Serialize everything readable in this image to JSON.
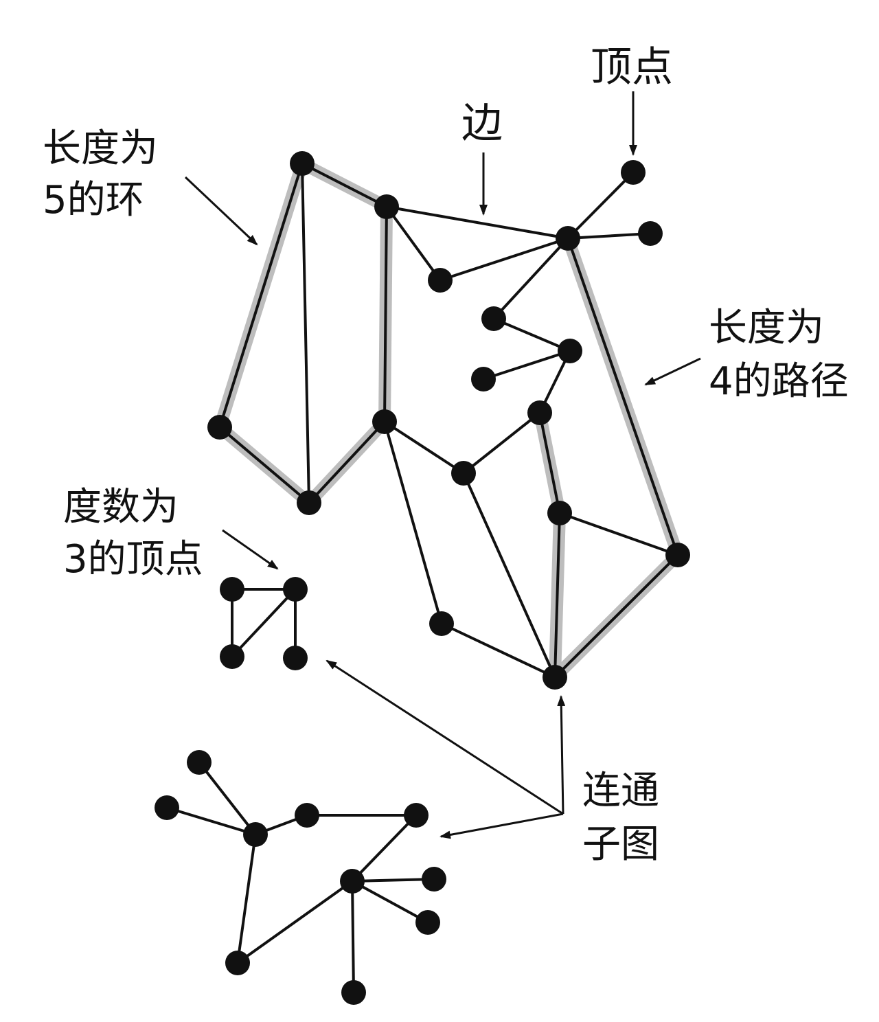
{
  "labels": {
    "vertex": "顶点",
    "edge": "边",
    "cycle": [
      "长度为",
      "5的环"
    ],
    "path": [
      "长度为",
      "4的路径"
    ],
    "degree": [
      "度数为",
      "3的顶点"
    ],
    "subgraph": [
      "连通",
      "子图"
    ]
  },
  "colors": {
    "ink": "#111111",
    "highlight": "#bdbdbd",
    "background": "#ffffff"
  }
}
